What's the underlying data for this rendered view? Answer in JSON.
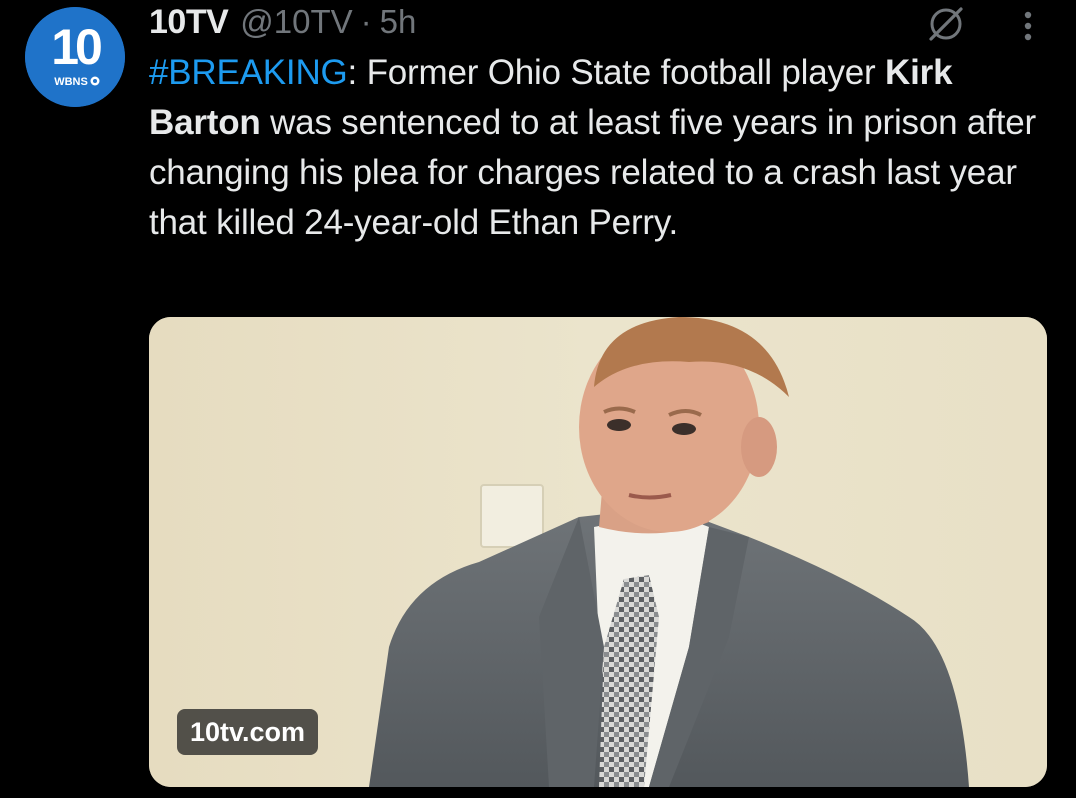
{
  "tweet": {
    "author": {
      "display_name": "10TV",
      "handle": "@10TV",
      "separator": "·",
      "time": "5h",
      "avatar": {
        "number": "10",
        "station": "WBNS",
        "color": "#1f73c9"
      }
    },
    "text": {
      "hashtag": "#BREAKING",
      "after_hashtag": ": Former Ohio State football player ",
      "bold_name": "Kirk Barton",
      "rest": " was sentenced to at least five years in prison after changing his plea for charges related to a crash last year that killed 24-year-old Ethan Perry."
    },
    "media": {
      "source_label": "10tv.com"
    },
    "icons": {
      "grok": "grok-icon",
      "more": "more-options-icon"
    }
  },
  "colors": {
    "background": "#000000",
    "text": "#e7e9ea",
    "secondary": "#71767b",
    "link": "#1d9bf0"
  }
}
